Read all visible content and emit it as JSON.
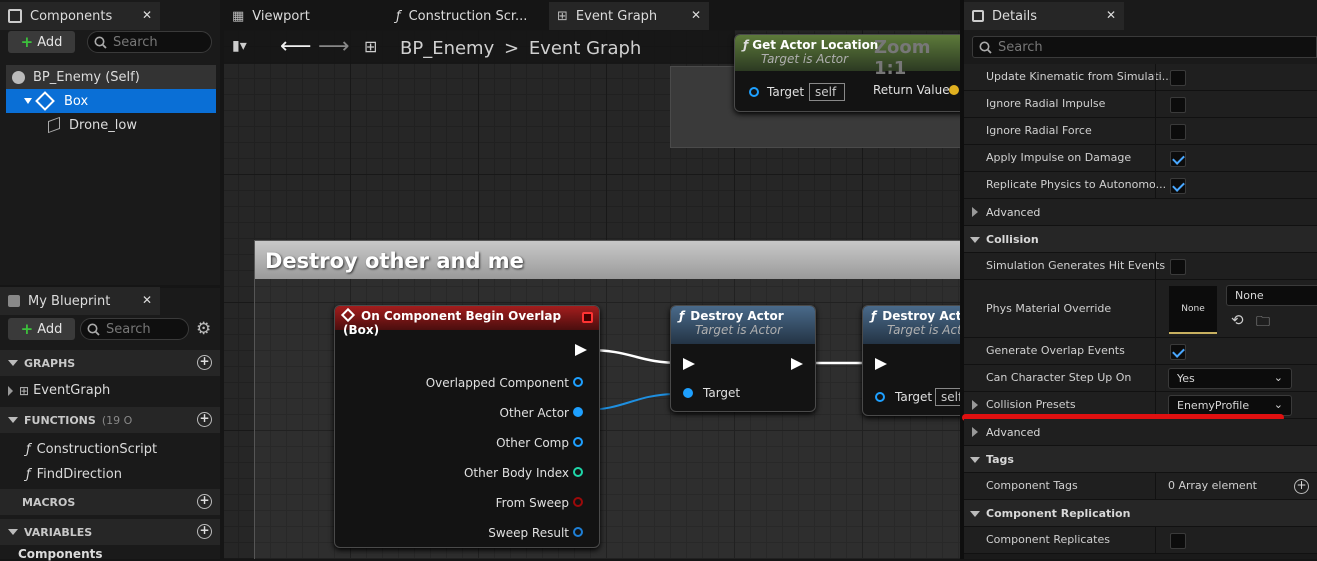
{
  "components": {
    "tab_title": "Components",
    "add_label": "Add",
    "search_placeholder": "Search",
    "tree": [
      {
        "label": "BP_Enemy (Self)"
      },
      {
        "label": "Box"
      },
      {
        "label": "Drone_low"
      }
    ]
  },
  "my_blueprint": {
    "tab_title": "My Blueprint",
    "add_label": "Add",
    "search_placeholder": "Search",
    "graphs_header": "GRAPHS",
    "graphs": [
      "EventGraph"
    ],
    "functions_header": "FUNCTIONS",
    "functions_count": "(19 O",
    "functions": [
      "ConstructionScript",
      "FindDirection"
    ],
    "macros_header": "MACROS",
    "variables_header": "VARIABLES",
    "variables_sub": "Components"
  },
  "editor_tabs": [
    {
      "label": "Viewport"
    },
    {
      "label": "Construction Scr..."
    },
    {
      "label": "Event Graph"
    }
  ],
  "breadcrumb": {
    "root": "BP_Enemy",
    "separator": ">",
    "current": "Event Graph"
  },
  "graph": {
    "zoom": "Zoom 1:1",
    "comment_title": "Destroy other and me",
    "node_get_location": {
      "title": "Get Actor Location",
      "subtitle": "Target is Actor",
      "target_label": "Target",
      "target_value": "self",
      "return_label": "Return Value"
    },
    "node_overlap": {
      "title": "On Component Begin Overlap (Box)",
      "pins": [
        "Overlapped Component",
        "Other Actor",
        "Other Comp",
        "Other Body Index",
        "From Sweep",
        "Sweep Result"
      ],
      "pin_colors": [
        "#1ea0ff",
        "#1ea0ff",
        "#1ea0ff",
        "#1fd6a8",
        "#9c0a0a",
        "#1e7fd6"
      ]
    },
    "node_destroy1": {
      "title": "Destroy Actor",
      "subtitle": "Target is Actor",
      "target_label": "Target"
    },
    "node_destroy2": {
      "title": "Destroy Act",
      "subtitle": "Target is Act",
      "target_label": "Target",
      "target_value": "self"
    }
  },
  "details": {
    "tab_title": "Details",
    "search_placeholder": "Search",
    "rows": [
      {
        "label": "Update Kinematic from Simulati...",
        "checked": false
      },
      {
        "label": "Ignore Radial Impulse",
        "checked": false
      },
      {
        "label": "Ignore Radial Force",
        "checked": false
      },
      {
        "label": "Apply Impulse on Damage",
        "checked": true
      },
      {
        "label": "Replicate Physics to Autonomo...",
        "checked": true
      }
    ],
    "advanced1": "Advanced",
    "collision_header": "Collision",
    "sim_hit_label": "Simulation Generates Hit Events",
    "phys_mat_label": "Phys Material Override",
    "phys_thumb": "None",
    "phys_value": "None",
    "overlap_label": "Generate Overlap Events",
    "step_label": "Can Character Step Up On",
    "step_value": "Yes",
    "presets_label": "Collision Presets",
    "presets_value": "EnemyProfile",
    "advanced2": "Advanced",
    "tags_header": "Tags",
    "comp_tags_label": "Component Tags",
    "comp_tags_value": "0 Array element",
    "replication_header": "Component Replication",
    "replicates_label": "Component Replicates"
  },
  "colors": {
    "selection": "#0a6fd6",
    "annotation": "#e01010",
    "event_node": "#8a1a1a",
    "function_node": "#4a6a8a",
    "pure_node": "#5d7a3a"
  }
}
